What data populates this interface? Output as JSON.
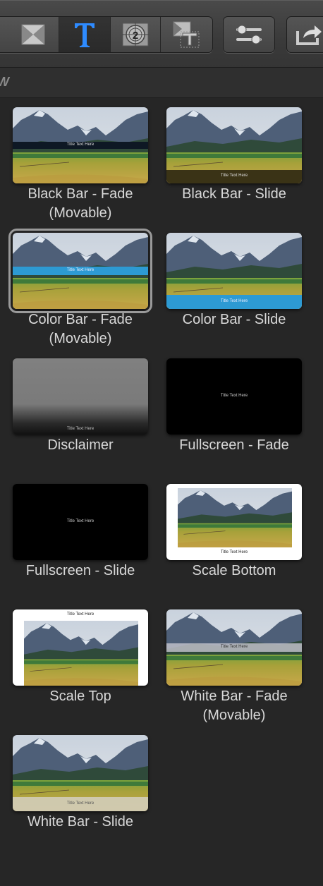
{
  "toolbar": {
    "buttons": [
      {
        "name": "transitions-browser-button",
        "icon": "transition-x-icon"
      },
      {
        "name": "titles-browser-button",
        "icon": "titles-T-icon",
        "selected": true
      },
      {
        "name": "generators-browser-button",
        "icon": "countdown-icon"
      },
      {
        "name": "themes-browser-button",
        "icon": "themes-icon"
      },
      {
        "name": "inspector-button",
        "icon": "sliders-icon"
      },
      {
        "name": "share-button",
        "icon": "share-icon"
      }
    ],
    "accent_color": "#2e8bff"
  },
  "browser": {
    "header_label": "W"
  },
  "titles": [
    {
      "label": "Black Bar - Fade\n(Movable)",
      "overlay": "Title Text Here",
      "style": "blackbar-fade"
    },
    {
      "label": "Black Bar - Slide",
      "overlay": "Title Text Here",
      "style": "blackbar-slide"
    },
    {
      "label": "Color Bar - Fade\n(Movable)",
      "overlay": "Title Text Here",
      "style": "colorbar-fade",
      "selected": true
    },
    {
      "label": "Color Bar - Slide",
      "overlay": "Title Text Here",
      "style": "colorbar-slide"
    },
    {
      "label": "Disclaimer",
      "overlay": "Title Text Here",
      "style": "disclaimer"
    },
    {
      "label": "Fullscreen - Fade",
      "overlay": "Title Text Here",
      "style": "fullscreen"
    },
    {
      "label": "Fullscreen - Slide",
      "overlay": "Title Text Here",
      "style": "fullscreen"
    },
    {
      "label": "Scale Bottom",
      "overlay": "Title Text Here",
      "style": "scale-bottom"
    },
    {
      "label": "Scale Top",
      "overlay": "Title Text Here",
      "style": "scale-top"
    },
    {
      "label": "White Bar - Fade\n(Movable)",
      "overlay": "Title Text Here",
      "style": "whitebar-fade"
    },
    {
      "label": "White Bar - Slide",
      "overlay": "Title Text Here",
      "style": "whitebar-slide"
    }
  ]
}
